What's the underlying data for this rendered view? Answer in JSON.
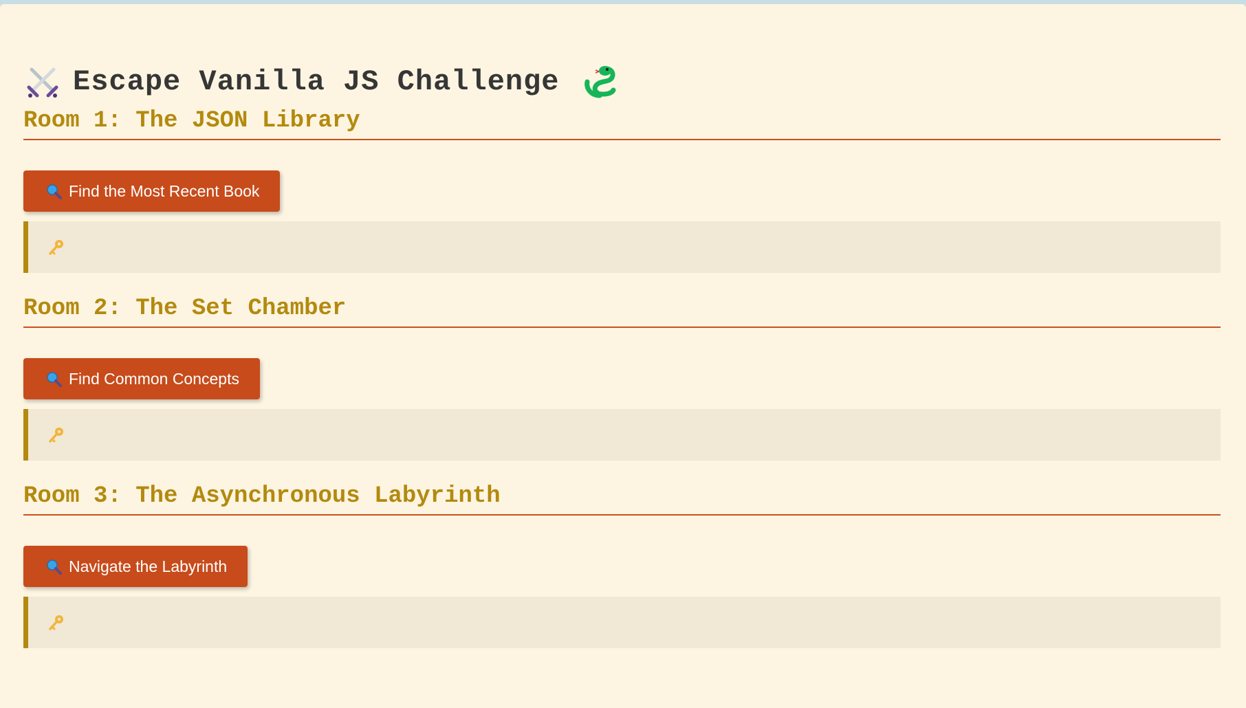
{
  "page": {
    "title": "Escape Vanilla JS Challenge",
    "title_icon_left": "crossed-swords-icon",
    "title_icon_right": "snake-icon"
  },
  "rooms": [
    {
      "title": "Room 1: The JSON Library",
      "button_label": "Find the Most Recent Book",
      "button_icon": "magnifying-glass-icon",
      "result_icon": "key-icon",
      "result_text": ""
    },
    {
      "title": "Room 2: The Set Chamber",
      "button_label": "Find Common Concepts",
      "button_icon": "magnifying-glass-icon",
      "result_icon": "key-icon",
      "result_text": ""
    },
    {
      "title": "Room 3: The Asynchronous Labyrinth",
      "button_label": "Navigate the Labyrinth",
      "button_icon": "magnifying-glass-icon",
      "result_icon": "key-icon",
      "result_text": ""
    }
  ],
  "colors": {
    "background": "#fdf5e2",
    "heading": "#363636",
    "room_title": "#b38a0f",
    "accent": "#c74b1b",
    "result_bg": "#f1e8d6"
  }
}
